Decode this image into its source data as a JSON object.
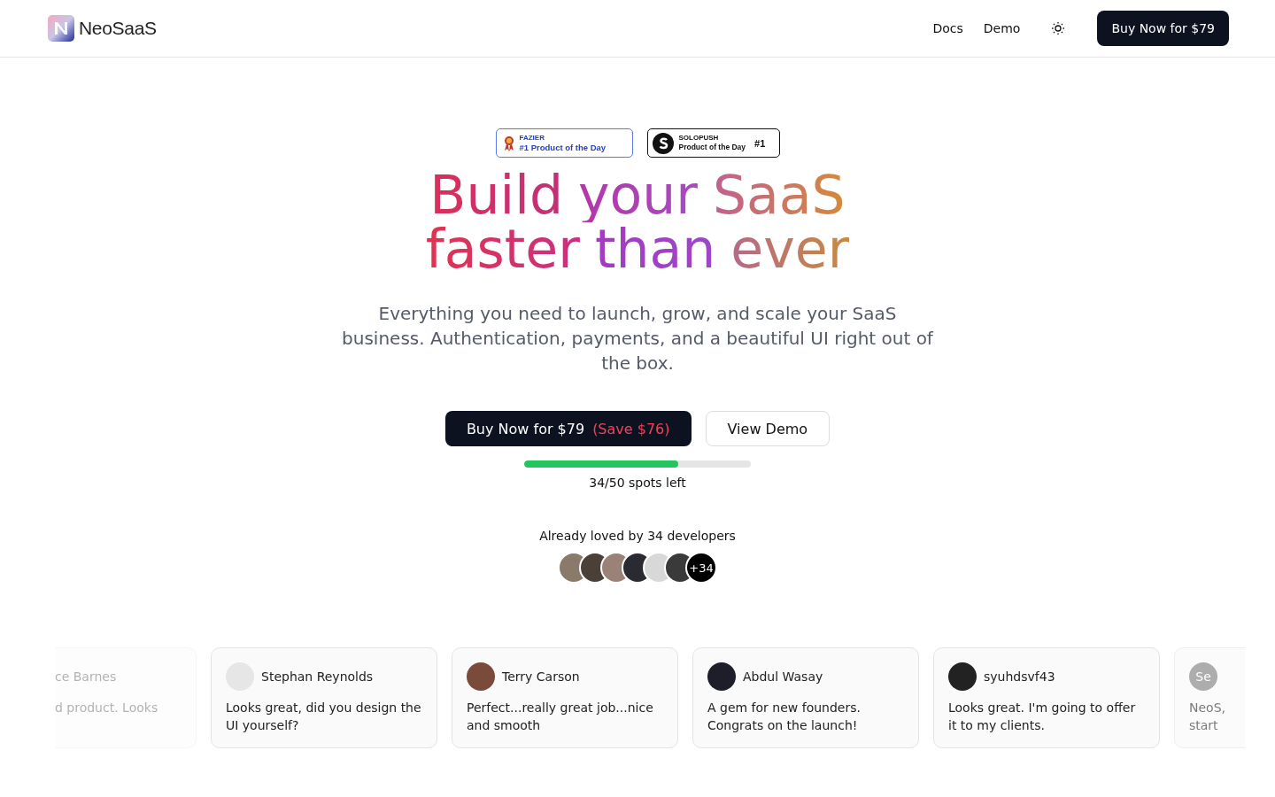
{
  "header": {
    "brand": "NeoSaaS",
    "nav": [
      "Docs",
      "Demo"
    ],
    "cta": "Buy Now for $79"
  },
  "badges": [
    {
      "kind": "fazier",
      "source": "FAZIER",
      "label": "#1 Product of the Day"
    },
    {
      "kind": "solopush",
      "source": "SOLOPUSH",
      "label": "Product of the Day",
      "rank": "#1"
    }
  ],
  "headline": {
    "line_1": [
      "Build",
      "your",
      "SaaS"
    ],
    "line_2": [
      "faster",
      "than",
      "ever"
    ]
  },
  "subtitle": "Everything you need to launch, grow, and scale your SaaS business. Authentication, payments, and a beautiful UI right out of the box.",
  "buttons": {
    "buy": "Buy Now for $79",
    "save": "(Save $76)",
    "demo": "View Demo"
  },
  "spots": {
    "level": 0.68,
    "text": "34/50 spots left"
  },
  "loved": {
    "text": "Already loved by 34 developers",
    "more": "+34"
  },
  "testimonials": [
    {
      "kind": "clipped_left",
      "name": "ce Barnes",
      "text": "d product. Looks"
    },
    {
      "kind": "full",
      "name": "Stephan Reynolds",
      "text": "Looks great, did you design the UI yourself?"
    },
    {
      "kind": "full",
      "name": "Terry Carson",
      "text": "Perfect...really great job...nice and smooth"
    },
    {
      "kind": "full",
      "name": "Abdul Wasay",
      "text": "A gem for new founders. Congrats on the launch!"
    },
    {
      "kind": "full",
      "name": "syuhdsvf43",
      "text": "Looks great. I'm going to offer it to my clients."
    },
    {
      "kind": "clipped_right",
      "initials": "Se",
      "text": "NeoS, start"
    }
  ]
}
